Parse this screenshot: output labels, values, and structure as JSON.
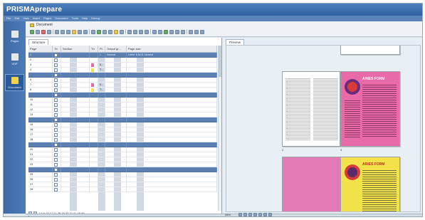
{
  "window": {
    "title": "PRISMAprepare"
  },
  "menubar": [
    "File",
    "Edit",
    "View",
    "Insert",
    "Pages",
    "Document",
    "Tools",
    "Help",
    "Debug"
  ],
  "leftnav": {
    "items": [
      {
        "label": "Pages",
        "icon": "pages-icon",
        "color": "#e8e8e8"
      },
      {
        "label": "VDP",
        "icon": "vdp-icon",
        "color": "#e8e8e8"
      },
      {
        "label": "Document",
        "icon": "document-icon",
        "color": "#f2d24a"
      }
    ]
  },
  "document": {
    "title": "Document"
  },
  "structure": {
    "tab_label": "Structure",
    "columns": [
      "Page",
      "Tb",
      "Section",
      "Th",
      "Pl..",
      "Output gr...",
      "Page size"
    ],
    "first_row": {
      "page": "1",
      "output": "Normal",
      "page_size": "Letter 8.5x11 Normal"
    },
    "rows": [
      {
        "page": "1",
        "sel": true,
        "thumb": "",
        "pl": "I..",
        "output": "Normal",
        "size": "Letter 8.5x11 Normal"
      },
      {
        "page": "2",
        "sel": false,
        "thumb": "",
        "pl": "",
        "output": "",
        "size": ""
      },
      {
        "page": "3",
        "sel": false,
        "thumb": "#e86aa8",
        "pl": "II...",
        "output": "",
        "size": ""
      },
      {
        "page": "4",
        "sel": false,
        "thumb": "#f3e24a",
        "pl": "T...",
        "output": "",
        "size": ""
      },
      {
        "page": "",
        "sel": true,
        "thumb": "",
        "pl": "",
        "output": "",
        "size": ""
      },
      {
        "page": "6",
        "sel": false,
        "thumb": "",
        "pl": "",
        "output": "",
        "size": ""
      },
      {
        "page": "7",
        "sel": false,
        "thumb": "#e86aa8",
        "pl": "II...",
        "output": "",
        "size": ""
      },
      {
        "page": "8",
        "sel": false,
        "thumb": "#f3e24a",
        "pl": "T...",
        "output": "",
        "size": ""
      },
      {
        "page": "",
        "sel": true,
        "thumb": "",
        "pl": "",
        "output": "",
        "size": ""
      },
      {
        "page": "10",
        "sel": false,
        "thumb": "",
        "pl": "",
        "output": "",
        "size": ""
      },
      {
        "page": "11",
        "sel": false,
        "thumb": "",
        "pl": "",
        "output": "",
        "size": ""
      },
      {
        "page": "12",
        "sel": false,
        "thumb": "",
        "pl": "",
        "output": "",
        "size": ""
      },
      {
        "page": "13",
        "sel": false,
        "thumb": "",
        "pl": "",
        "output": "",
        "size": ""
      },
      {
        "page": "",
        "sel": true,
        "thumb": "",
        "pl": "",
        "output": "",
        "size": ""
      },
      {
        "page": "15",
        "sel": false,
        "thumb": "",
        "pl": "",
        "output": "",
        "size": ""
      },
      {
        "page": "16",
        "sel": false,
        "thumb": "",
        "pl": "",
        "output": "",
        "size": ""
      },
      {
        "page": "17",
        "sel": false,
        "thumb": "",
        "pl": "",
        "output": "",
        "size": ""
      },
      {
        "page": "18",
        "sel": false,
        "thumb": "",
        "pl": "",
        "output": "",
        "size": ""
      },
      {
        "page": "",
        "sel": true,
        "thumb": "",
        "pl": "",
        "output": "",
        "size": ""
      },
      {
        "page": "20",
        "sel": false,
        "thumb": "",
        "pl": "",
        "output": "",
        "size": ""
      },
      {
        "page": "21",
        "sel": false,
        "thumb": "",
        "pl": "",
        "output": "",
        "size": ""
      },
      {
        "page": "22",
        "sel": false,
        "thumb": "",
        "pl": "",
        "output": "",
        "size": ""
      },
      {
        "page": "23",
        "sel": false,
        "thumb": "",
        "pl": "",
        "output": "",
        "size": ""
      },
      {
        "page": "",
        "sel": true,
        "thumb": "",
        "pl": "",
        "output": "",
        "size": ""
      },
      {
        "page": "25",
        "sel": false,
        "thumb": "",
        "pl": "",
        "output": "",
        "size": ""
      },
      {
        "page": "26",
        "sel": false,
        "thumb": "",
        "pl": "",
        "output": "",
        "size": ""
      },
      {
        "page": "27",
        "sel": false,
        "thumb": "",
        "pl": "",
        "output": "",
        "size": ""
      },
      {
        "page": "28",
        "sel": false,
        "thumb": "",
        "pl": "",
        "output": "",
        "size": ""
      }
    ],
    "status_pages": "1,5,9,13,17,21,25,29,33,37,41,45,49"
  },
  "preview": {
    "tab_label": "Preview",
    "page_labels": [
      "2",
      "3",
      "4",
      "5"
    ],
    "form_title": "ARIES FORM",
    "zoom": "28%"
  }
}
